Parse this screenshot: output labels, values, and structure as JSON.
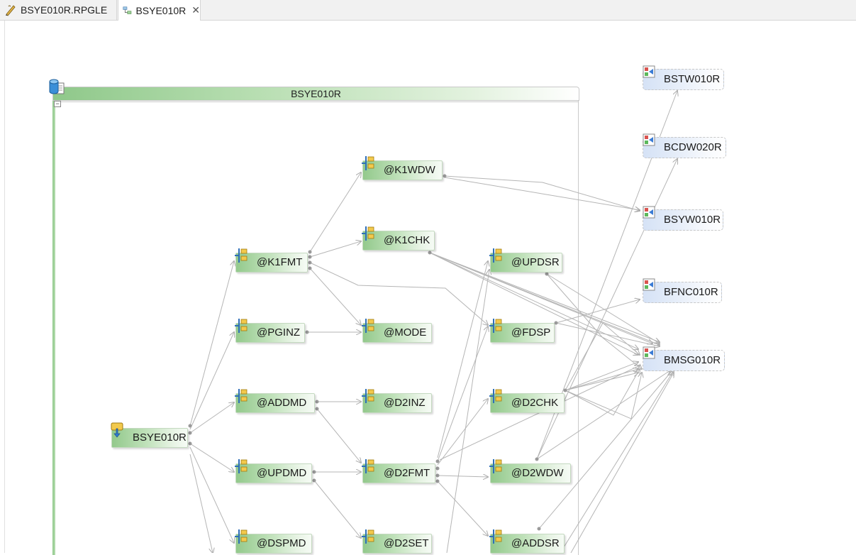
{
  "tabs": [
    {
      "label": "BSYE010R.RPGLE",
      "icon": "rpgle-source-icon"
    },
    {
      "label": "BSYE010R",
      "icon": "call-diagram-icon"
    }
  ],
  "container": {
    "title": "BSYE010R"
  },
  "nodes": {
    "main": "BSYE010R",
    "k1fmt": "@K1FMT",
    "pginz": "@PGINZ",
    "addmd": "@ADDMD",
    "updmd": "@UPDMD",
    "dspmd": "@DSPMD",
    "k1wdw": "@K1WDW",
    "k1chk": "@K1CHK",
    "mode": "@MODE",
    "d2inz": "@D2INZ",
    "d2fmt": "@D2FMT",
    "d2set": "@D2SET",
    "updsr": "@UPDSR",
    "fdsp": "@FDSP",
    "d2chk": "@D2CHK",
    "d2wdw": "@D2WDW",
    "addsr": "@ADDSR"
  },
  "externals": {
    "bstw": "BSTW010R",
    "bcdw": "BCDW020R",
    "bsyw": "BSYW010R",
    "bfnc": "BFNC010R",
    "bmsg": "BMSG010R"
  },
  "colors": {
    "procedure_fill": "#93c98c",
    "program_fill": "#d5e2f6",
    "edge": "#aaaaaa"
  }
}
